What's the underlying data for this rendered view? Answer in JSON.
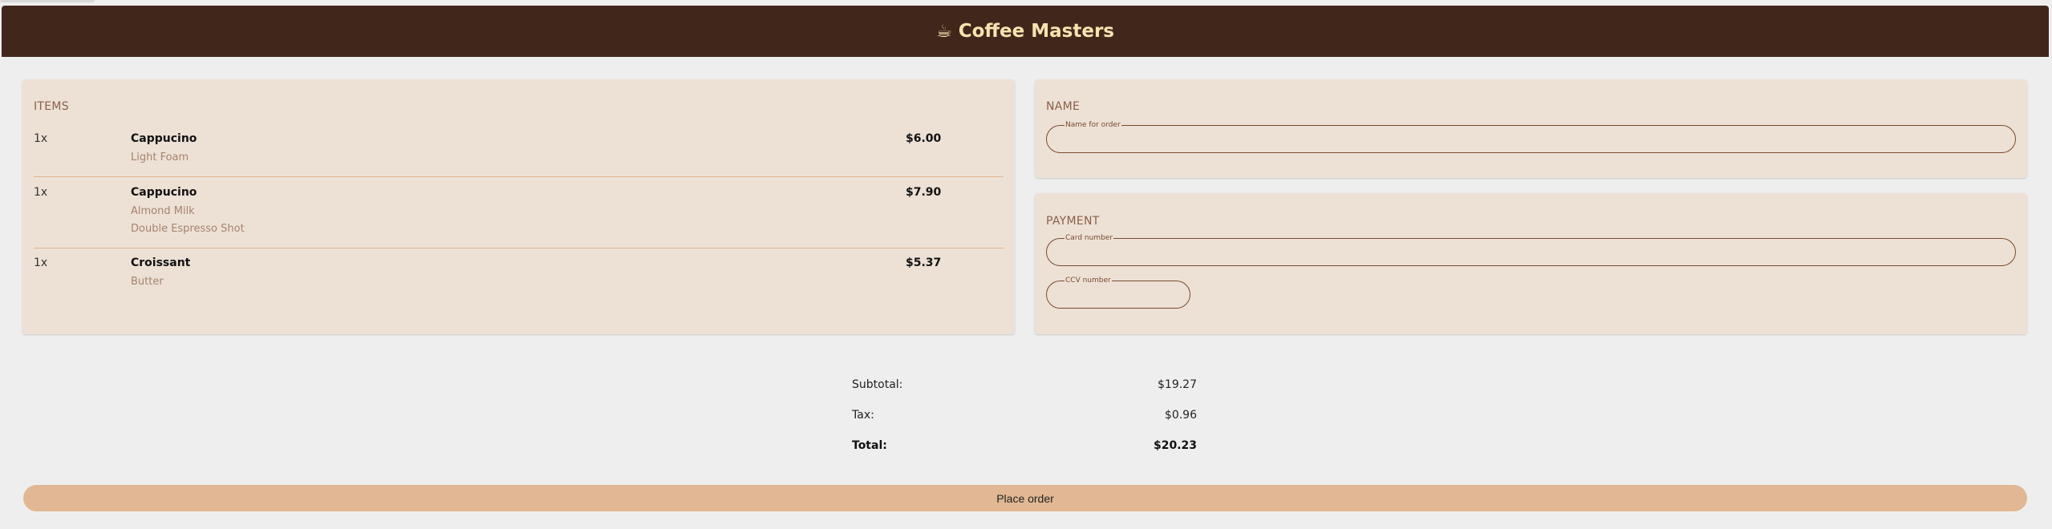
{
  "header": {
    "icon": "coffee-cup-icon",
    "icon_glyph": "☕︎",
    "title": "Coffee Masters",
    "background": "#41271b",
    "title_color": "#f6e4b0"
  },
  "items": {
    "title": "ITEMS",
    "list": [
      {
        "qty": "1x",
        "name": "Cappucino",
        "price": "$6.00",
        "options": [
          "Light Foam"
        ]
      },
      {
        "qty": "1x",
        "name": "Cappucino",
        "price": "$7.90",
        "options": [
          "Almond Milk",
          "Double Espresso Shot"
        ]
      },
      {
        "qty": "1x",
        "name": "Croissant",
        "price": "$5.37",
        "options": [
          "Butter"
        ]
      }
    ]
  },
  "name_section": {
    "title": "NAME",
    "field_label": "Name for order",
    "value": ""
  },
  "payment_section": {
    "title": "PAYMENT",
    "card_label": "Card number",
    "card_value": "",
    "ccv_label": "CCV number",
    "ccv_value": ""
  },
  "totals": {
    "subtotal_label": "Subtotal:",
    "subtotal_value": "$19.27",
    "tax_label": "Tax:",
    "tax_value": "$0.96",
    "total_label": "Total:",
    "total_value": "$20.23"
  },
  "place_order_label": "Place order",
  "colors": {
    "accent": "#e1b893",
    "card_bg": "#ede1d6",
    "divider": "#e0b38e",
    "muted_text": "#a7836c"
  }
}
